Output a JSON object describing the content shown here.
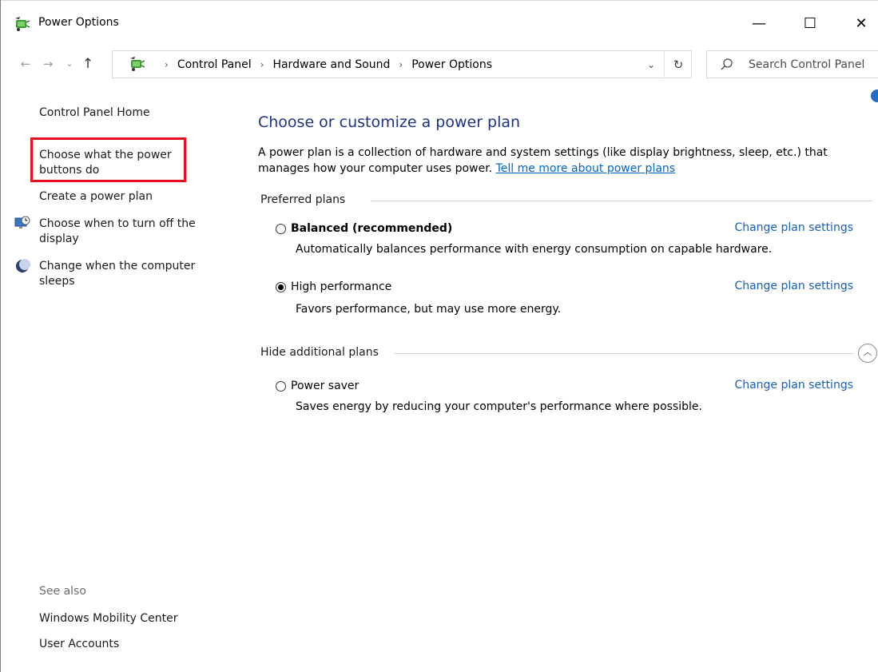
{
  "window": {
    "title": "Power Options",
    "controls": {
      "minimize": "—",
      "maximize": "☐",
      "close": "✕"
    }
  },
  "nav": {
    "back": "←",
    "forward": "→",
    "recent": "⌄",
    "up": "↑",
    "breadcrumbs": [
      "Control Panel",
      "Hardware and Sound",
      "Power Options"
    ],
    "separator": "›",
    "dropdown": "⌄",
    "refresh": "↻"
  },
  "search": {
    "placeholder": "Search Control Panel"
  },
  "sidebar": {
    "home": "Control Panel Home",
    "links": [
      {
        "label_line1": "Choose what the power",
        "label_line2": "buttons do"
      },
      {
        "label": "Create a power plan"
      },
      {
        "label_line1": "Choose when to turn off the",
        "label_line2": "display"
      },
      {
        "label_line1": "Change when the computer",
        "label_line2": "sleeps"
      }
    ],
    "see_also": {
      "heading": "See also",
      "items": [
        "Windows Mobility Center",
        "User Accounts"
      ]
    }
  },
  "main": {
    "title": "Choose or customize a power plan",
    "description": "A power plan is a collection of hardware and system settings (like display brightness, sleep, etc.) that manages how your computer uses power. ",
    "description_link": "Tell me more about power plans",
    "preferred_header": "Preferred plans",
    "hidden_header": "Hide additional plans",
    "change_label": "Change plan settings",
    "plans": [
      {
        "name": "Balanced (recommended)",
        "desc": "Automatically balances performance with energy consumption on capable hardware.",
        "selected": false
      },
      {
        "name": "High performance",
        "desc": "Favors performance, but may use more energy.",
        "selected": true
      },
      {
        "name": "Power saver",
        "desc": "Saves energy by reducing your computer's performance where possible.",
        "selected": false
      }
    ]
  },
  "colors": {
    "title_blue": "#1e3287",
    "link_blue": "#0066cc",
    "highlight_red": "#e81123"
  }
}
